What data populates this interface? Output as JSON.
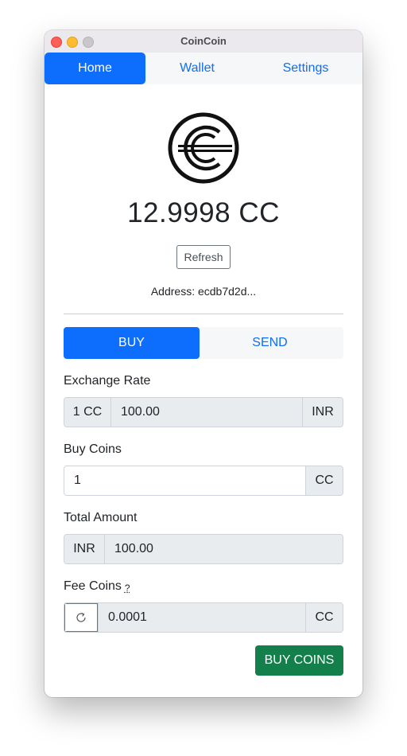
{
  "window": {
    "title": "CoinCoin"
  },
  "nav": {
    "items": [
      "Home",
      "Wallet",
      "Settings"
    ],
    "active": "Home"
  },
  "wallet": {
    "balance": "12.9998 CC",
    "refresh_label": "Refresh",
    "address_label": "Address: ecdb7d2d..."
  },
  "tabs": {
    "buy": "BUY",
    "send": "SEND",
    "active": "BUY"
  },
  "form": {
    "exchange_rate": {
      "label": "Exchange Rate",
      "prefix": "1 CC",
      "value": "100.00",
      "suffix": "INR"
    },
    "buy_coins": {
      "label": "Buy Coins",
      "value": "1",
      "suffix": "CC"
    },
    "total_amount": {
      "label": "Total Amount",
      "prefix": "INR",
      "value": "100.00"
    },
    "fee_coins": {
      "label": "Fee Coins",
      "help": "?",
      "value": "0.0001",
      "suffix": "CC"
    },
    "submit_label": "BUY COINS"
  },
  "colors": {
    "primary": "#0d6efd",
    "success": "#13804c",
    "addon_bg": "#e9ecef"
  },
  "icons": {
    "logo": "coincoin-logo-icon",
    "fee_refresh": "refresh-icon"
  }
}
